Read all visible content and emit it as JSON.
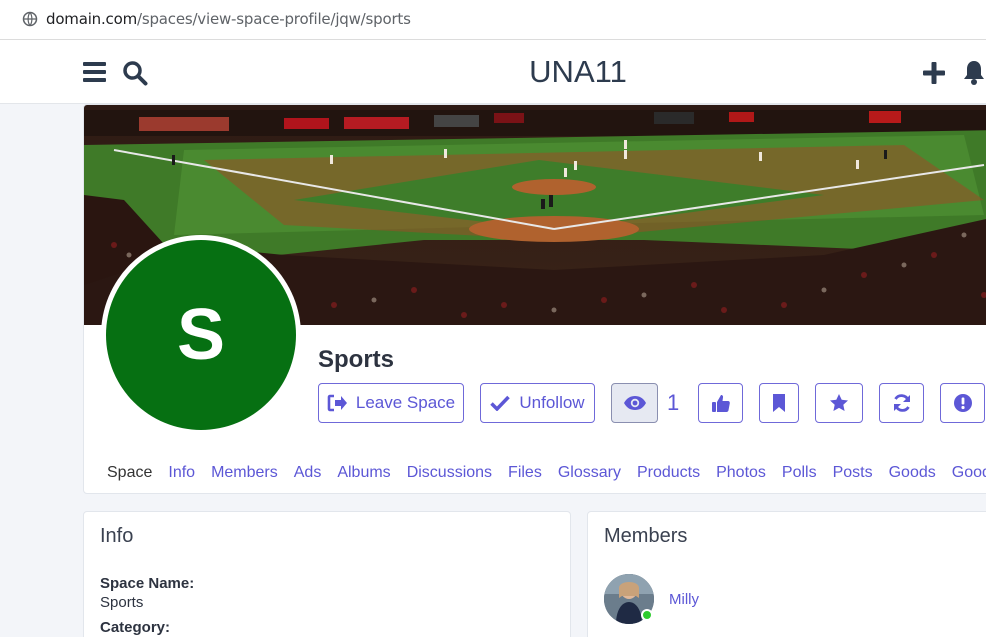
{
  "browser": {
    "url_domain": "domain.com",
    "url_path": "/spaces/view-space-profile/jqw/sports"
  },
  "header": {
    "title": "UNA11",
    "menu_icon": "hamburger-menu-icon",
    "search_icon": "search-icon",
    "add_icon": "plus-icon",
    "notifications_icon": "bell-icon"
  },
  "space": {
    "avatar_letter": "S",
    "avatar_color": "#067012",
    "name": "Sports",
    "cover_description": "baseball-stadium-cover"
  },
  "actions": {
    "leave_label": "Leave Space",
    "unfollow_label": "Unfollow",
    "views_count": "1"
  },
  "tabs": [
    "Space",
    "Info",
    "Members",
    "Ads",
    "Albums",
    "Discussions",
    "Files",
    "Glossary",
    "Products",
    "Photos",
    "Polls",
    "Posts",
    "Goods",
    "Goods"
  ],
  "info_panel": {
    "title": "Info",
    "space_name_label": "Space Name:",
    "space_name_value": "Sports",
    "category_label": "Category:"
  },
  "members_panel": {
    "title": "Members",
    "members": [
      {
        "name": "Milly",
        "online": true
      }
    ]
  },
  "colors": {
    "accent": "#5c57d6",
    "text_dark": "#2d3340"
  }
}
